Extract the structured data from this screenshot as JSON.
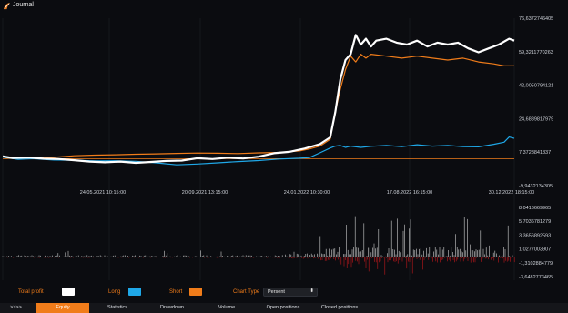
{
  "window": {
    "title": "Journal"
  },
  "colors": {
    "background": "#0b0c10",
    "total": "#ffffff",
    "long": "#1fa8e8",
    "short": "#f07c1a",
    "volume_pos": "#cfcfcf",
    "volume_neg": "#c0181c",
    "accent": "#f07c1a"
  },
  "chart_data": [
    {
      "type": "line",
      "ylim": [
        -9.9432134305,
        76.6372746405
      ],
      "y_ticks": [
        "76,6372746405",
        "59,3211770263",
        "42,0050794121",
        "24,6889817979",
        "7,3728841837",
        "-9,9432134305"
      ],
      "x_ticks": [
        "24.05.2021 10:15:00",
        "20.09.2021 13:15:00",
        "24.01.2022 10:30:00",
        "17.08.2022 16:15:00",
        "30.12.2022 18:15:00"
      ],
      "series": [
        {
          "name": "Total profit",
          "x": [
            0,
            2,
            5,
            8,
            11,
            14,
            17,
            20,
            23,
            26,
            29,
            32,
            35,
            38,
            41,
            44,
            47,
            50,
            53,
            56,
            59,
            62,
            64,
            65,
            66,
            67,
            68,
            69,
            70,
            71,
            72,
            73,
            75,
            77,
            79,
            81,
            83,
            85,
            87,
            89,
            91,
            93,
            95,
            97,
            99,
            100
          ],
          "values": [
            5.2,
            4.3,
            4.6,
            4.0,
            3.8,
            3.2,
            2.5,
            2.1,
            2.5,
            1.8,
            2.3,
            2.8,
            3.0,
            4.2,
            3.8,
            4.5,
            4.1,
            5.0,
            6.8,
            7.5,
            9.2,
            11.5,
            15,
            28,
            45,
            55,
            58,
            68,
            63,
            66,
            62,
            65,
            66,
            64,
            63,
            65,
            62,
            64,
            63,
            64,
            61,
            59,
            61,
            63,
            66,
            65
          ]
        },
        {
          "name": "Long",
          "x": [
            0,
            3,
            6,
            10,
            14,
            18,
            22,
            26,
            30,
            34,
            38,
            42,
            46,
            50,
            54,
            58,
            60,
            62,
            64,
            65,
            66,
            67,
            68,
            70,
            72,
            75,
            78,
            81,
            84,
            87,
            90,
            93,
            96,
            98,
            99,
            100
          ],
          "values": [
            4.8,
            3.6,
            4.0,
            3.3,
            3.2,
            2.8,
            2.9,
            2.6,
            1.8,
            0.8,
            1.2,
            1.8,
            2.5,
            3.0,
            3.8,
            4.2,
            4.6,
            7.0,
            9.5,
            10.5,
            10.8,
            9.8,
            10.5,
            9.8,
            10.4,
            10.8,
            10.2,
            11.2,
            10.5,
            10.8,
            10.2,
            10.1,
            11.4,
            12.5,
            15.2,
            14.5
          ]
        },
        {
          "name": "Short",
          "x": [
            0,
            3,
            6,
            10,
            14,
            18,
            22,
            26,
            30,
            34,
            38,
            42,
            46,
            50,
            54,
            58,
            60,
            62,
            64,
            65,
            66,
            67,
            68,
            69,
            70,
            71,
            72,
            75,
            78,
            81,
            84,
            87,
            90,
            93,
            96,
            98,
            100
          ],
          "values": [
            5.0,
            4.5,
            4.2,
            4.7,
            5.5,
            5.8,
            6.0,
            6.3,
            6.5,
            6.7,
            6.9,
            6.8,
            6.6,
            7.0,
            7.2,
            8.0,
            9.0,
            10.5,
            14,
            28,
            40,
            50,
            57,
            54,
            58,
            56,
            58,
            57,
            56,
            57,
            56,
            55,
            56,
            54,
            53,
            52,
            52
          ]
        }
      ],
      "threshold": 4.0
    },
    {
      "type": "bar",
      "ylim": [
        -3.6482773465,
        8.0416669965
      ],
      "y_ticks": [
        "8,0416669965",
        "5,7036781279",
        "3,3656892593",
        "1,0277003907",
        "-1,3102884779",
        "-3,6482773465"
      ]
    }
  ],
  "legend": {
    "total_profit": "Total profit",
    "long": "Long",
    "short": "Short",
    "chart_type": "Chart Type",
    "chart_type_value": "Persent"
  },
  "tabs": {
    "more": ">>>>",
    "items": [
      "Equity",
      "Statistics",
      "Drawdown",
      "Volume",
      "Open positions",
      "Closed positions"
    ],
    "active": 0
  }
}
